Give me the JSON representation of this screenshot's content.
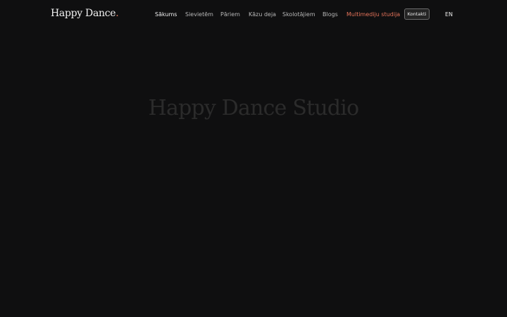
{
  "header": {
    "logo_text": "Happy Dance",
    "logo_dot": ".",
    "nav": [
      {
        "label": "Sākums"
      },
      {
        "label": "Sievietēm"
      },
      {
        "label": "Pāriem"
      },
      {
        "label": "Kāzu deja"
      },
      {
        "label": "Skolotājiem"
      },
      {
        "label": "Blogs"
      },
      {
        "label": "Multimediju studija"
      }
    ],
    "contact_label": "Kontakti",
    "language_label": "EN"
  },
  "hero": {
    "title": "Happy Dance Studio"
  },
  "colors": {
    "background": "#0f0f10",
    "accent": "#e5735a",
    "hero_text": "#2b2b2b"
  }
}
